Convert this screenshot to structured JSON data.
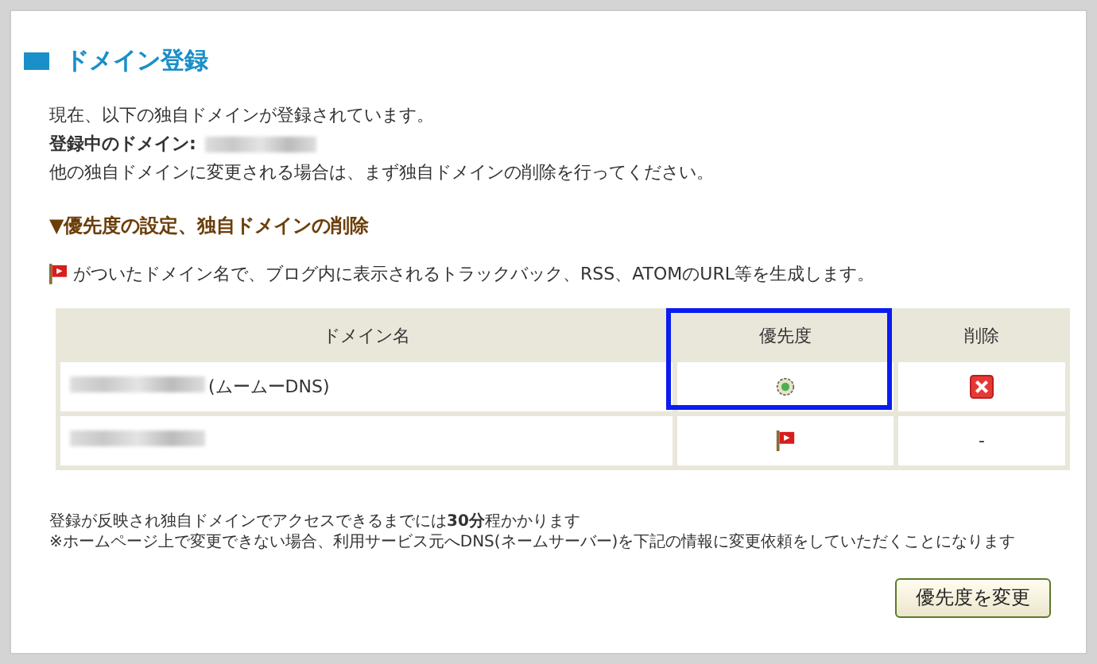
{
  "title": "ドメイン登録",
  "intro": [
    "現在、以下の独自ドメインが登録されています。",
    "**登録中のドメイン:**",
    "他の独自ドメインに変更される場合は、まず独自ドメインの削除を行ってください。"
  ],
  "section_heading": "▼優先度の設定、独自ドメインの削除",
  "flag_note": "がついたドメイン名で、ブログ内に表示されるトラックバック、RSS、ATOMのURL等を生成します。",
  "table": {
    "columns": [
      "ドメイン名",
      "優先度",
      "削除"
    ],
    "rows": [
      {
        "domain_suffix": "(ムームーDNS)",
        "priority": {
          "kind": "radio",
          "selected": true
        },
        "delete": {
          "kind": "icon"
        }
      },
      {
        "domain_suffix": "",
        "priority": {
          "kind": "flag",
          "selected": false
        },
        "delete": {
          "kind": "text",
          "text": "-"
        }
      }
    ]
  },
  "notes": [
    "登録が反映され独自ドメインでアクセスできるまでには**30分**程かかります",
    "※ホームページ上で変更できない場合、利用サービス元へDNS(ネームサーバー)を下記の情報に変更依頼をしていただくことになります"
  ],
  "button": "優先度を変更"
}
